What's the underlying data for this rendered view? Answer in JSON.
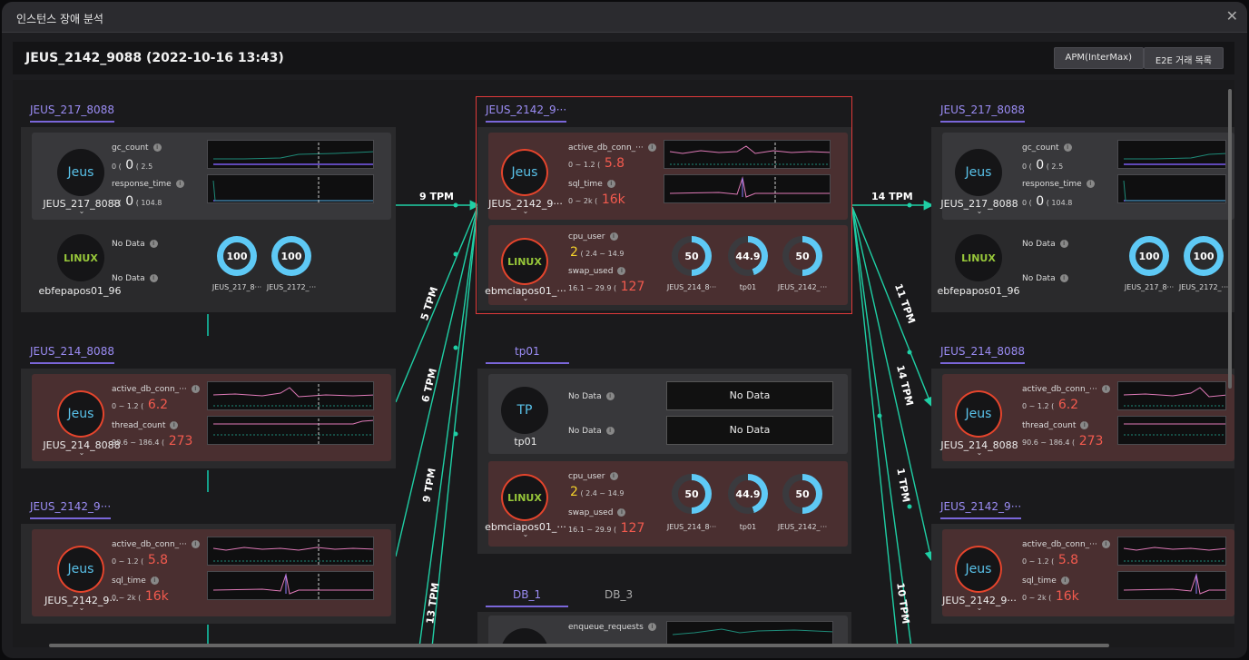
{
  "window": {
    "title": "인스턴스 장애 분석",
    "close_label": "✕"
  },
  "header": {
    "title": "JEUS_2142_9088 (2022-10-16 13:43)",
    "buttons": [
      "APM(InterMax)",
      "E2E 거래 목록"
    ]
  },
  "tabs": {
    "left1": "JEUS_217_8088",
    "left2": "JEUS_214_8088",
    "left3": "JEUS_2142_9···",
    "center1": "JEUS_2142_9···",
    "center2": "tp01",
    "db1": "DB_1",
    "db2": "DB_3",
    "right1": "JEUS_217_8088",
    "right2": "JEUS_214_8088",
    "right3": "JEUS_2142_9···"
  },
  "nodes": {
    "jeus": "Jeus",
    "linux": "LINUX",
    "tp": "TP",
    "chev": "⌄",
    "l1": "JEUS_217_8088",
    "l1os": "ebfepapos01_96",
    "l2": "JEUS_214_8088",
    "l3": "JEUS_2142_9···",
    "c1": "JEUS_2142_9···",
    "c1os": "ebmciapos01_···",
    "c2": "tp01",
    "c2os": "ebmciapos01_···",
    "r1": "JEUS_217_8088",
    "r1os": "ebfepapos01_96",
    "r2": "JEUS_214_8088",
    "r3": "JEUS_2142_9···"
  },
  "metrics": {
    "gc_count": "gc_count",
    "gc_range": "0 ( ",
    "gc_val": "0",
    "gc_max": "( 2.5",
    "resp": "response_time",
    "resp_range": "0 ( ",
    "resp_val": "0",
    "resp_max": "( 104.8",
    "nodata": "No Data",
    "nodata_big": "No Data",
    "adb": "active_db_conn_···",
    "adb_range": "0 ~ 1.2 ( ",
    "adb_val_c": "5.8",
    "adb_val_l": "6.2",
    "sql": "sql_time",
    "sql_range": "0 ~ 2k ( ",
    "sql_val": "16k",
    "thread": "thread_count",
    "thread_range": "90.6 ~ 186.4 ( ",
    "thread_val": "273",
    "cpu": "cpu_user",
    "cpu_range": "( 2.4 ~ 14.9",
    "cpu_val": "2",
    "swap": "swap_used",
    "swap_range": "16.1 ~ 29.9 ( ",
    "swap_val": "127",
    "enq": "enqueue_requests",
    "info": "i"
  },
  "donuts": {
    "v100": "100",
    "v50": "50",
    "v449": "44.9",
    "a": "JEUS_217_8···",
    "b": "JEUS_2172_···",
    "c": "JEUS_214_8···",
    "d": "tp01",
    "e": "JEUS_2142_···"
  },
  "tpm": {
    "a": "9 TPM",
    "b": "5 TPM",
    "c": "6 TPM",
    "d": "9 TPM",
    "e": "13 TPM",
    "f": "14 TPM",
    "g": "11 TPM",
    "h": "14 TPM",
    "i": "1 TPM",
    "j": "10 TPM"
  },
  "colors": {
    "accent": "#7a66d9",
    "flow": "#1fcfa5",
    "alert": "#e03a3a",
    "gauge": "#5ec9f5"
  }
}
